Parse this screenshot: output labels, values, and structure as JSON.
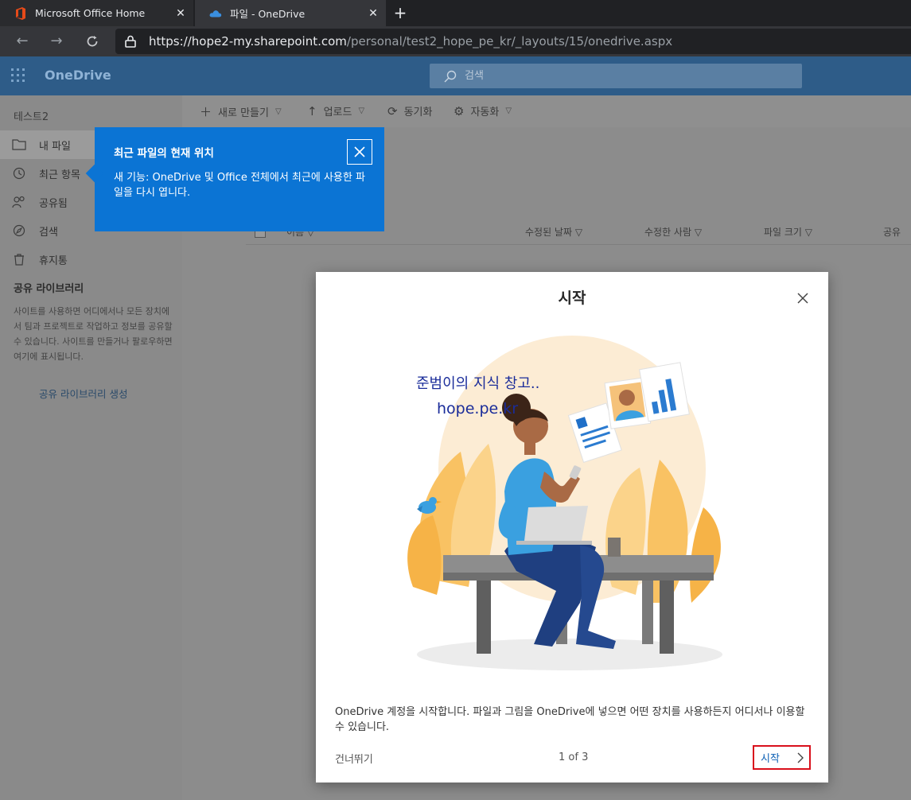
{
  "browser": {
    "tabs": [
      {
        "label": "Microsoft Office Home",
        "icon": "office-icon",
        "active": false
      },
      {
        "label": "파일 - OneDrive",
        "icon": "onedrive-cloud-icon",
        "active": true
      }
    ],
    "url_host": "https://hope2-my.sharepoint.com",
    "url_path": "/personal/test2_hope_pe_kr/_layouts/15/onedrive.aspx"
  },
  "header": {
    "app_name": "OneDrive",
    "search_placeholder": "검색"
  },
  "nav": {
    "user": "테스트2",
    "items": [
      {
        "label": "내 파일",
        "icon": "folder-icon"
      },
      {
        "label": "최근 항목",
        "icon": "clock-icon"
      },
      {
        "label": "공유됨",
        "icon": "people-icon"
      },
      {
        "label": "검색",
        "icon": "discover-icon"
      },
      {
        "label": "휴지통",
        "icon": "recycle-bin-icon"
      }
    ],
    "section_title": "공유 라이브러리",
    "section_desc": "사이트를 사용하면 어디에서나 모든 장치에서 팀과 프로젝트로 작업하고 정보를 공유할 수 있습니다. 사이트를 만들거나 팔로우하면 여기에 표시됩니다.",
    "create_link": "공유 라이브러리 생성"
  },
  "commands": {
    "new": "새로 만들기",
    "upload": "업로드",
    "sync": "동기화",
    "automate": "자동화"
  },
  "columns": {
    "name": "이름",
    "modified": "수정된 날짜",
    "modified_by": "수정한 사람",
    "size": "파일 크기",
    "sharing": "공유"
  },
  "callout": {
    "title": "최근 파일의 현재 위치",
    "body": "새 기능: OneDrive 및 Office 전체에서 최근에 사용한 파일을 다시 엽니다."
  },
  "dialog": {
    "title": "시작",
    "watermark_line1": "준범이의 지식 창고..",
    "watermark_line2": "hope.pe.kr",
    "description": "OneDrive 계정을 시작합니다. 파일과 그림을 OneDrive에 넣으면 어떤 장치를 사용하든지 어디서나 이용할 수 있습니다.",
    "skip": "건너뛰기",
    "page": "1 of 3",
    "start": "시작"
  },
  "colors": {
    "header_bg": "#2e5c88",
    "callout_bg": "#0b74d4",
    "highlight_border": "#d9101c"
  }
}
